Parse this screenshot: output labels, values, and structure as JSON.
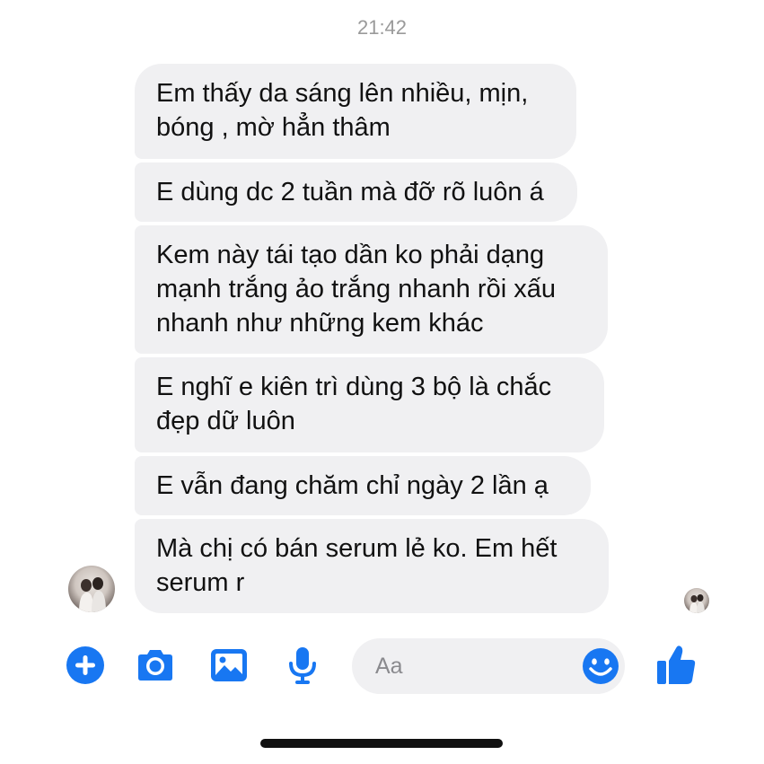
{
  "status": {
    "time": "21:42"
  },
  "thread": {
    "messages": [
      {
        "text": "Em thấy da sáng lên nhiều, mịn,\nbóng , mờ hẳn thâm"
      },
      {
        "text": "E dùng dc 2 tuần mà đỡ rõ luôn á"
      },
      {
        "text": "Kem này tái tạo dần ko phải dạng\nmạnh trắng ảo trắng nhanh rồi xấu\nnhanh như những kem khác"
      },
      {
        "text": "E nghĩ e kiên trì dùng 3 bộ là chắc\nđẹp dữ luôn"
      },
      {
        "text": "E vẫn đang chăm chỉ ngày 2 lần ạ"
      },
      {
        "text": "Mà chị có bán serum lẻ ko. Em hết\nserum r"
      }
    ]
  },
  "composer": {
    "placeholder": "Aa",
    "icons": [
      "plus-icon",
      "camera-icon",
      "image-icon",
      "microphone-icon",
      "emoji-icon",
      "thumbs-up-icon"
    ],
    "accent_color": "#1877f2"
  },
  "colors": {
    "bubble": "#f0f0f2",
    "text": "#111111",
    "timestamp": "#9a9a9a"
  }
}
